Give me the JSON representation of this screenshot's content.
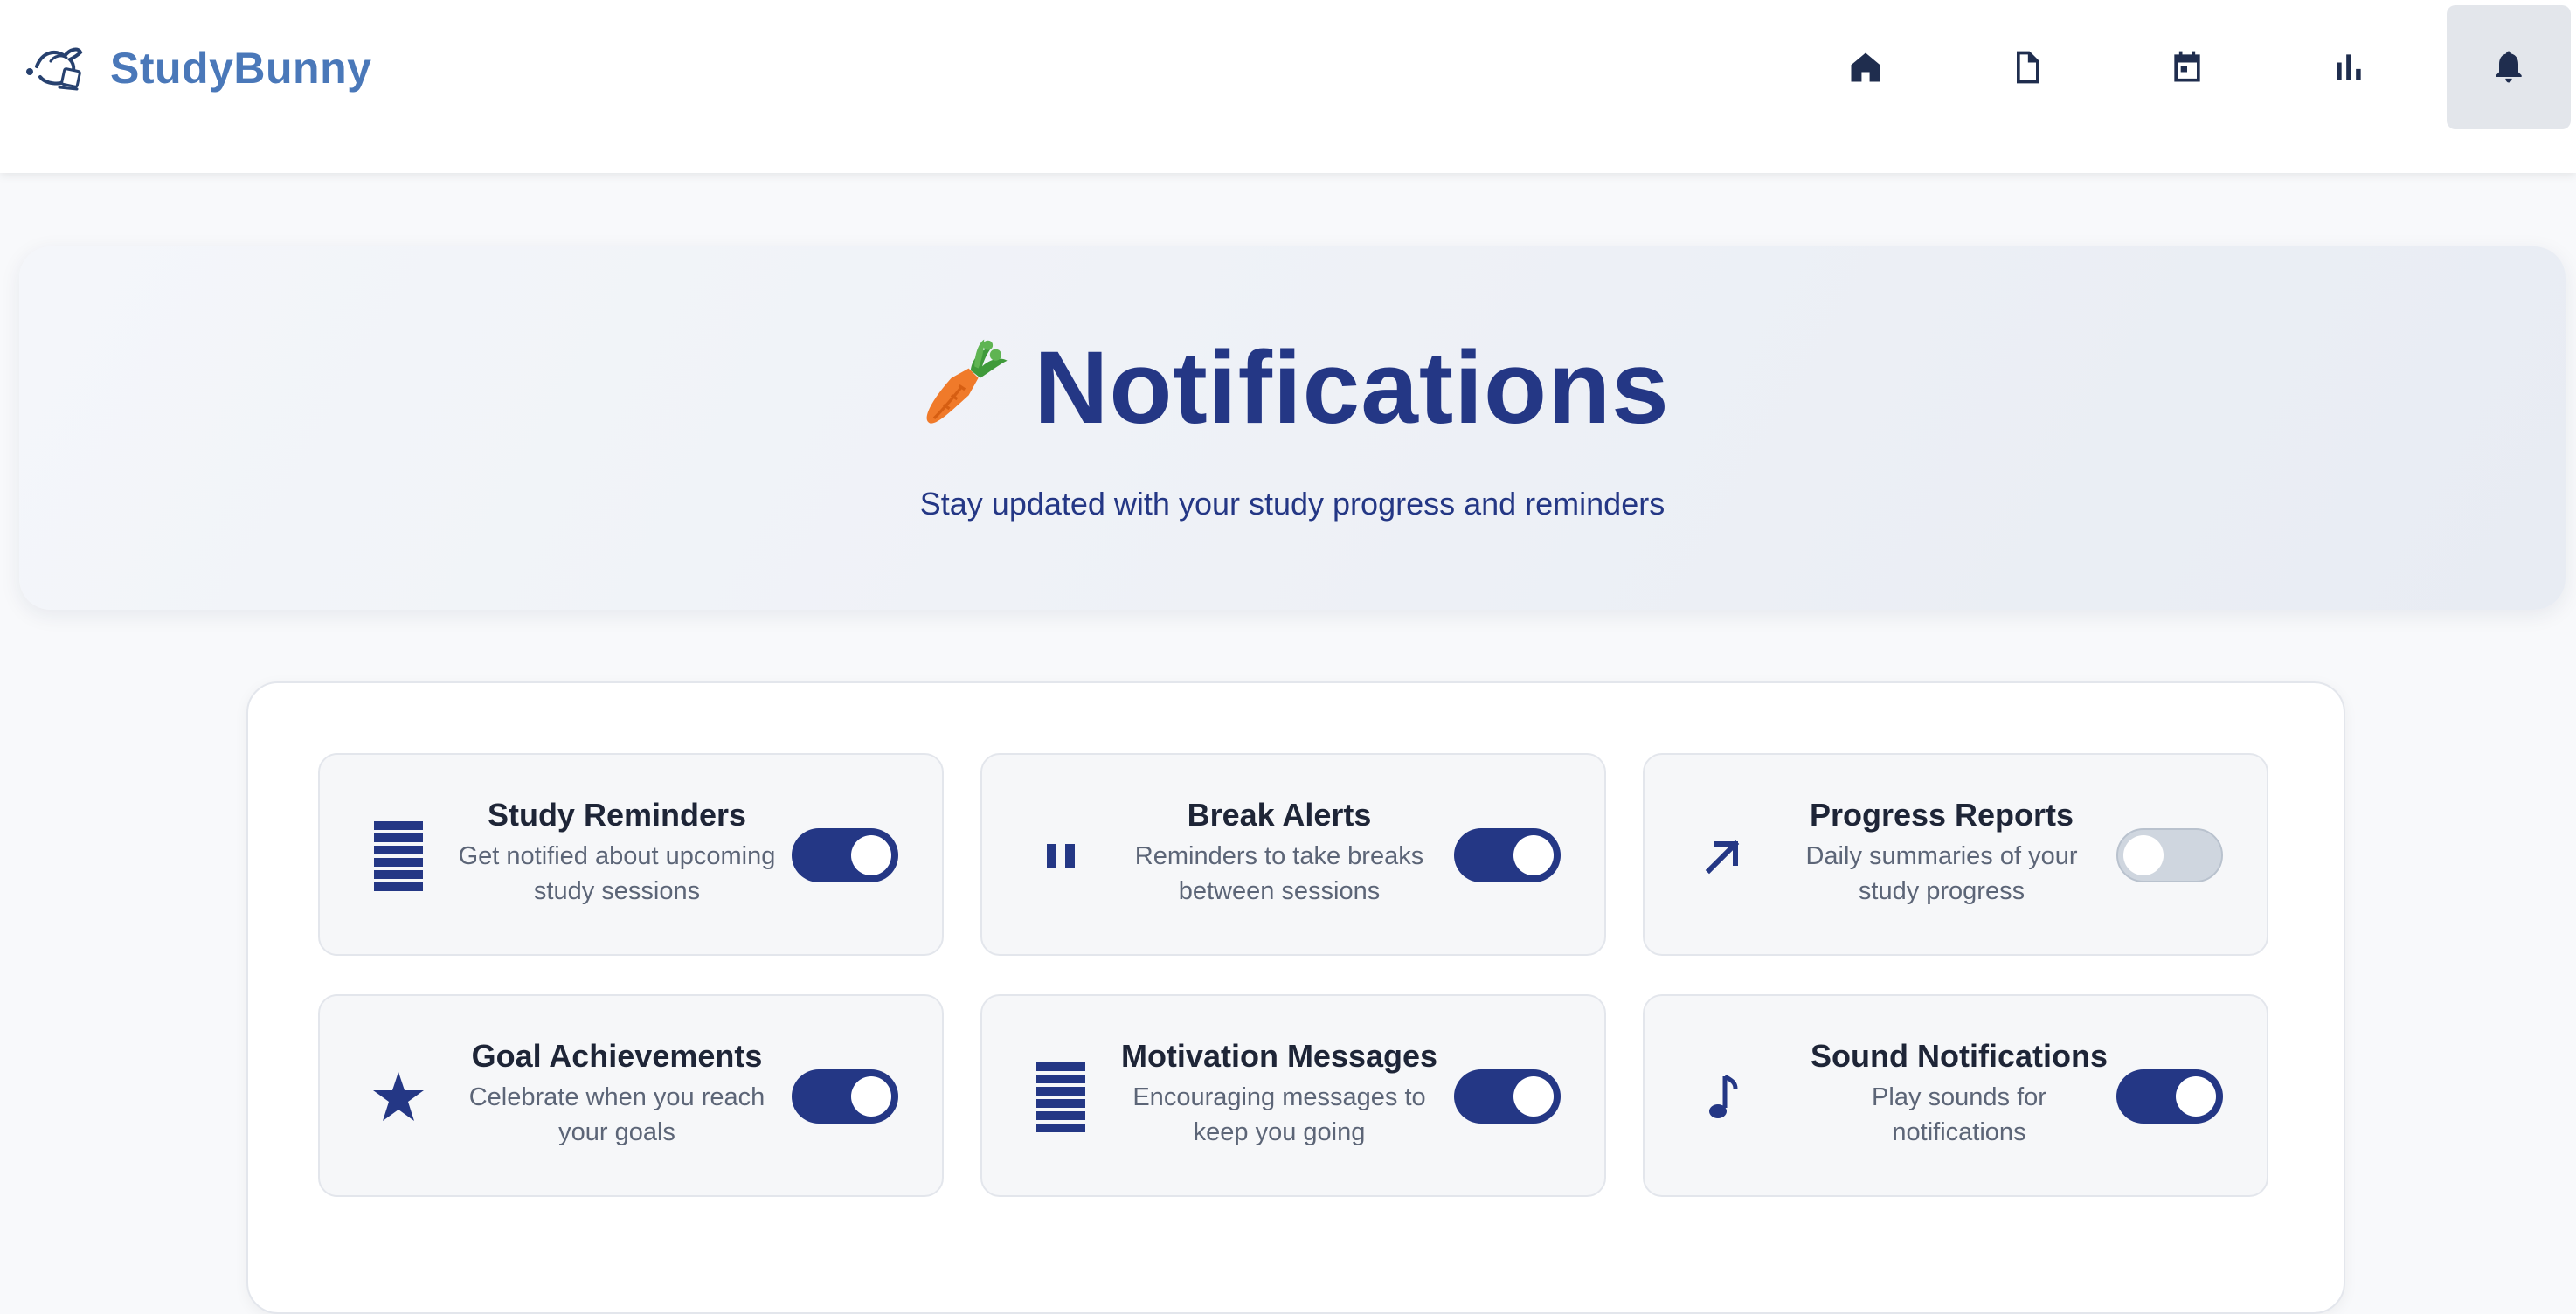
{
  "brand": {
    "name": "StudyBunny"
  },
  "nav": [
    {
      "name": "home",
      "icon": "home-icon",
      "active": false
    },
    {
      "name": "documents",
      "icon": "document-icon",
      "active": false
    },
    {
      "name": "calendar",
      "icon": "calendar-icon",
      "active": false
    },
    {
      "name": "stats",
      "icon": "bar-chart-icon",
      "active": false
    },
    {
      "name": "notifications",
      "icon": "bell-icon",
      "active": true
    }
  ],
  "hero": {
    "title": "Notifications",
    "emoji": "carrot-icon",
    "subtitle": "Stay updated with your study progress and reminders"
  },
  "settings": [
    {
      "title": "Study Reminders",
      "desc_line1": "Get notified about upcoming",
      "desc_line2": "study sessions",
      "icon": "book-stack-icon",
      "enabled": true
    },
    {
      "title": "Break Alerts",
      "desc_line1": "Reminders to take breaks",
      "desc_line2": "between sessions",
      "icon": "pause-icon",
      "enabled": true
    },
    {
      "title": "Progress Reports",
      "desc_line1": "Daily summaries of your",
      "desc_line2": "study progress",
      "icon": "arrow-up-right-icon",
      "enabled": false
    },
    {
      "title": "Goal Achievements",
      "desc_line1": "Celebrate when you reach",
      "desc_line2": "your goals",
      "icon": "star-icon",
      "enabled": true
    },
    {
      "title": "Motivation Messages",
      "desc_line1": "Encouraging messages to",
      "desc_line2": "keep you going",
      "icon": "book-stack-icon",
      "enabled": true
    },
    {
      "title": "Sound Notifications",
      "desc_line1": "Play sounds for",
      "desc_line2": "notifications",
      "icon": "music-note-icon",
      "enabled": true
    }
  ],
  "colors": {
    "accent": "#243785",
    "brand": "#4a78b9",
    "toggle_off": "#cfd6df"
  }
}
